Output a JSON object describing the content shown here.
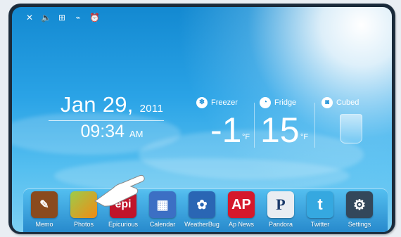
{
  "status_icons": [
    "close-icon",
    "volume-icon",
    "network-icon",
    "wifi-icon",
    "alarm-icon"
  ],
  "clock": {
    "date": "Jan 29,",
    "year": "2011",
    "time": "09:34",
    "ampm": "AM"
  },
  "fridge": {
    "freezer": {
      "label": "Freezer",
      "value": "-1",
      "unit": "°F"
    },
    "fridge": {
      "label": "Fridge",
      "value": "15",
      "unit": "°F"
    },
    "ice": {
      "label": "Cubed"
    }
  },
  "dock": [
    {
      "label": "Memo",
      "glyph": "✎",
      "color": "#8a4a1e"
    },
    {
      "label": "Photos",
      "glyph": "",
      "color": "#f28a14"
    },
    {
      "label": "Epicurious",
      "glyph": "epi",
      "color": "#c0142a"
    },
    {
      "label": "Calendar",
      "glyph": "▦",
      "color": "#3c6fc4"
    },
    {
      "label": "WeatherBug",
      "glyph": "✿",
      "color": "#2a66b4"
    },
    {
      "label": "Ap News",
      "glyph": "AP",
      "color": "#d5182b"
    },
    {
      "label": "Pandora",
      "glyph": "P",
      "color": "#e9edf2"
    },
    {
      "label": "Twitter",
      "glyph": "t",
      "color": "#35a8e0"
    },
    {
      "label": "Settings",
      "glyph": "⚙",
      "color": "#33475a"
    }
  ]
}
